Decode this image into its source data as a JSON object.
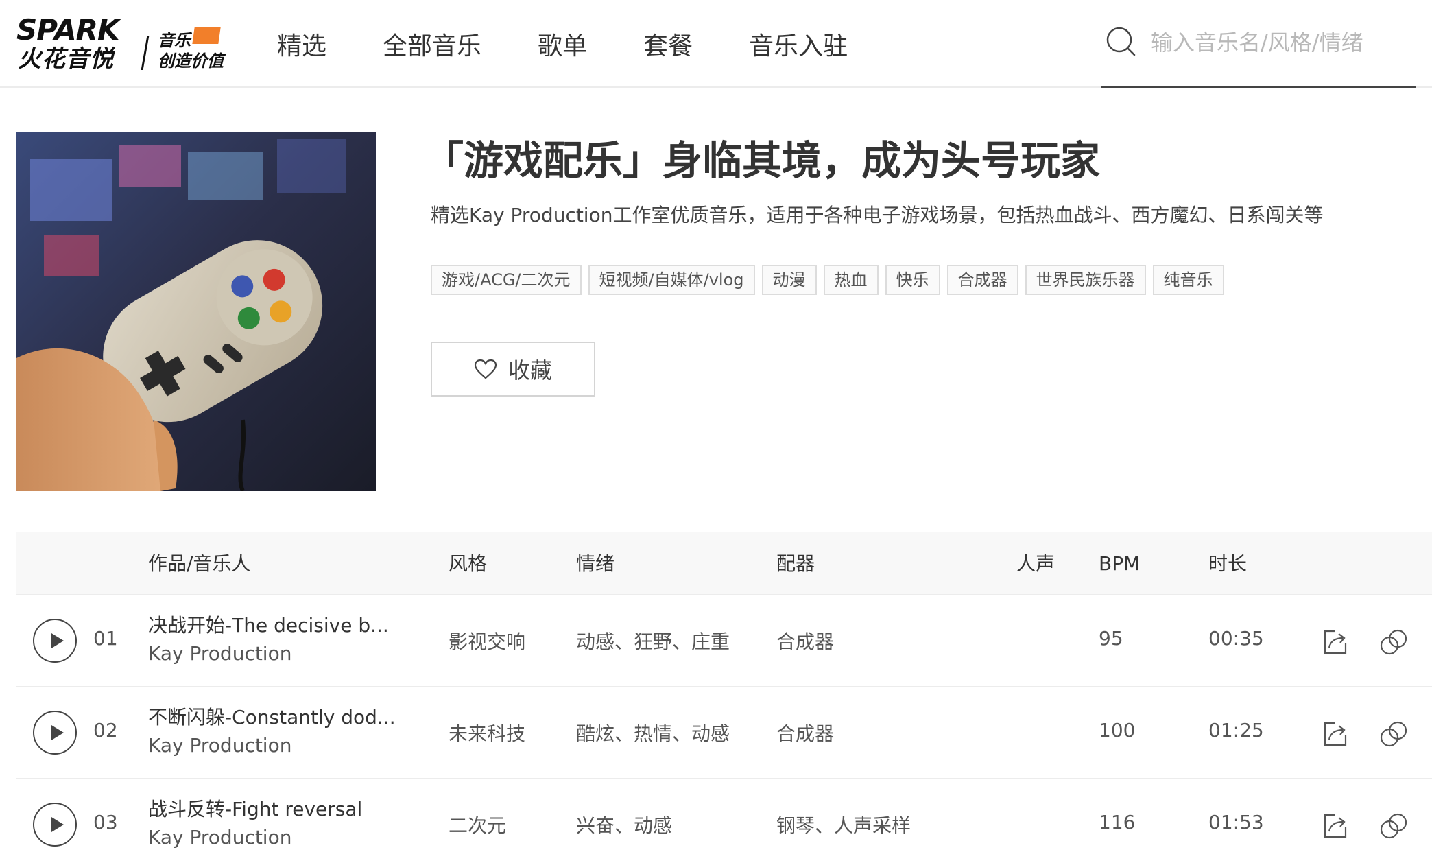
{
  "header": {
    "logo": {
      "spark": "SPARK",
      "cn": "火花音悦",
      "slogan_line1": "音乐",
      "slogan_line2": "创造价值"
    },
    "nav": [
      "精选",
      "全部音乐",
      "歌单",
      "套餐",
      "音乐入驻"
    ],
    "search": {
      "placeholder": "输入音乐名/风格/情绪"
    }
  },
  "playlist": {
    "title": "「游戏配乐」身临其境，成为头号玩家",
    "description": "精选Kay Production工作室优质音乐，适用于各种电子游戏场景，包括热血战斗、西方魔幻、日系闯关等",
    "tags": [
      "游戏/ACG/二次元",
      "短视频/自媒体/vlog",
      "动漫",
      "热血",
      "快乐",
      "合成器",
      "世界民族乐器",
      "纯音乐"
    ],
    "favorite_label": "收藏"
  },
  "table": {
    "headers": {
      "work": "作品/音乐人",
      "style": "风格",
      "mood": "情绪",
      "instrument": "配器",
      "vocal": "人声",
      "bpm": "BPM",
      "duration": "时长"
    },
    "rows": [
      {
        "num": "01",
        "title": "决战开始-The decisive b...",
        "artist": "Kay Production",
        "style": "影视交响",
        "mood": "动感、狂野、庄重",
        "instrument": "合成器",
        "bpm": "95",
        "duration": "00:35"
      },
      {
        "num": "02",
        "title": "不断闪躲-Constantly dod...",
        "artist": "Kay Production",
        "style": "未来科技",
        "mood": "酷炫、热情、动感",
        "instrument": "合成器",
        "bpm": "100",
        "duration": "01:25"
      },
      {
        "num": "03",
        "title": "战斗反转-Fight reversal",
        "artist": "Kay Production",
        "style": "二次元",
        "mood": "兴奋、动感",
        "instrument": "钢琴、人声采样",
        "bpm": "116",
        "duration": "01:53"
      }
    ]
  },
  "colors": {
    "accent": "#f27f2a",
    "text": "#333333",
    "muted": "#b8b8b8",
    "border": "#ececec"
  }
}
